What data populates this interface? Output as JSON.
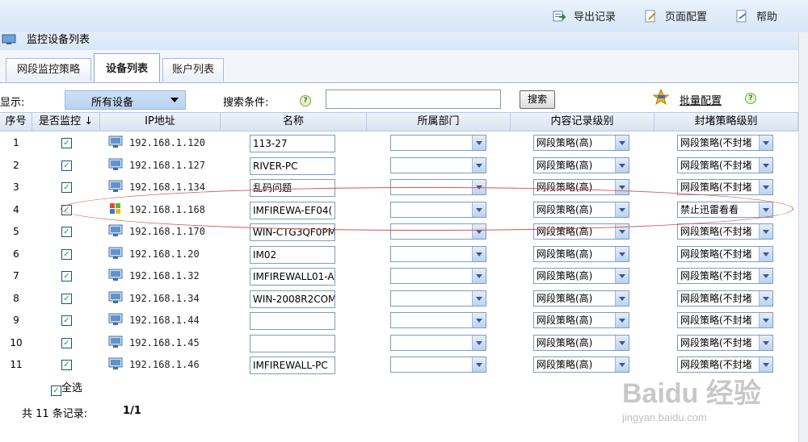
{
  "toolbar": {
    "export": "导出记录",
    "page_config": "页面配置",
    "help": "帮助"
  },
  "title": "监控设备列表",
  "tabs": [
    {
      "label": "网段监控策略",
      "active": false
    },
    {
      "label": "设备列表",
      "active": true
    },
    {
      "label": "账户列表",
      "active": false
    }
  ],
  "filter": {
    "show_label": "显示:",
    "show_value": "所有设备",
    "search_label": "搜索条件:",
    "search_value": "",
    "search_button": "搜索",
    "batch_label": "批量配置"
  },
  "columns": [
    "序号",
    "是否监控 ↓",
    "IP地址",
    "名称",
    "所属部门",
    "内容记录级别",
    "封堵策略级别"
  ],
  "rows": [
    {
      "seq": "1",
      "monitored": true,
      "icon": "pc-icon",
      "ip": "192.168.1.120",
      "name": "113-27",
      "dept": "",
      "content": "网段策略(高)",
      "block": "网段策略(不封堵"
    },
    {
      "seq": "2",
      "monitored": true,
      "icon": "pc-icon",
      "ip": "192.168.1.127",
      "name": "RIVER-PC",
      "dept": "",
      "content": "网段策略(高)",
      "block": "网段策略(不封堵"
    },
    {
      "seq": "3",
      "monitored": true,
      "icon": "pc-icon",
      "ip": "192.168.1.134",
      "name": "乱码问题",
      "dept": "",
      "content": "网段策略(高)",
      "block": "网段策略(不封堵"
    },
    {
      "seq": "4",
      "monitored": true,
      "icon": "windows-icon",
      "ip": "192.168.1.168",
      "name": "IMFIREWA-EF04(",
      "dept": "",
      "content": "网段策略(高)",
      "block": "禁止迅雷看看"
    },
    {
      "seq": "5",
      "monitored": true,
      "icon": "pc-icon",
      "ip": "192.168.1.170",
      "name": "WIN-CTG3QF0PM",
      "dept": "",
      "content": "网段策略(高)",
      "block": "网段策略(不封堵"
    },
    {
      "seq": "6",
      "monitored": true,
      "icon": "pc-icon",
      "ip": "192.168.1.20",
      "name": "IM02",
      "dept": "",
      "content": "网段策略(高)",
      "block": "网段策略(不封堵"
    },
    {
      "seq": "7",
      "monitored": true,
      "icon": "pc-icon",
      "ip": "192.168.1.32",
      "name": "IMFIREWALL01-A",
      "dept": "",
      "content": "网段策略(高)",
      "block": "网段策略(不封堵"
    },
    {
      "seq": "8",
      "monitored": true,
      "icon": "pc-icon",
      "ip": "192.168.1.34",
      "name": "WIN-2008R2COM",
      "dept": "",
      "content": "网段策略(高)",
      "block": "网段策略(不封堵"
    },
    {
      "seq": "9",
      "monitored": true,
      "icon": "pc-icon",
      "ip": "192.168.1.44",
      "name": "",
      "dept": "",
      "content": "网段策略(高)",
      "block": "网段策略(不封堵"
    },
    {
      "seq": "10",
      "monitored": true,
      "icon": "pc-icon",
      "ip": "192.168.1.45",
      "name": "",
      "dept": "",
      "content": "网段策略(高)",
      "block": "网段策略(不封堵"
    },
    {
      "seq": "11",
      "monitored": true,
      "icon": "pc-icon",
      "ip": "192.168.1.46",
      "name": "IMFIREWALL-PC",
      "dept": "",
      "content": "网段策略(高)",
      "block": "网段策略(不封堵"
    }
  ],
  "select_all_label": "全选",
  "records_label": "共 11 条记录:",
  "page_indicator": "1/1",
  "watermark": "Baidu 经验",
  "watermark_sub": "jingyan.baidu.com"
}
